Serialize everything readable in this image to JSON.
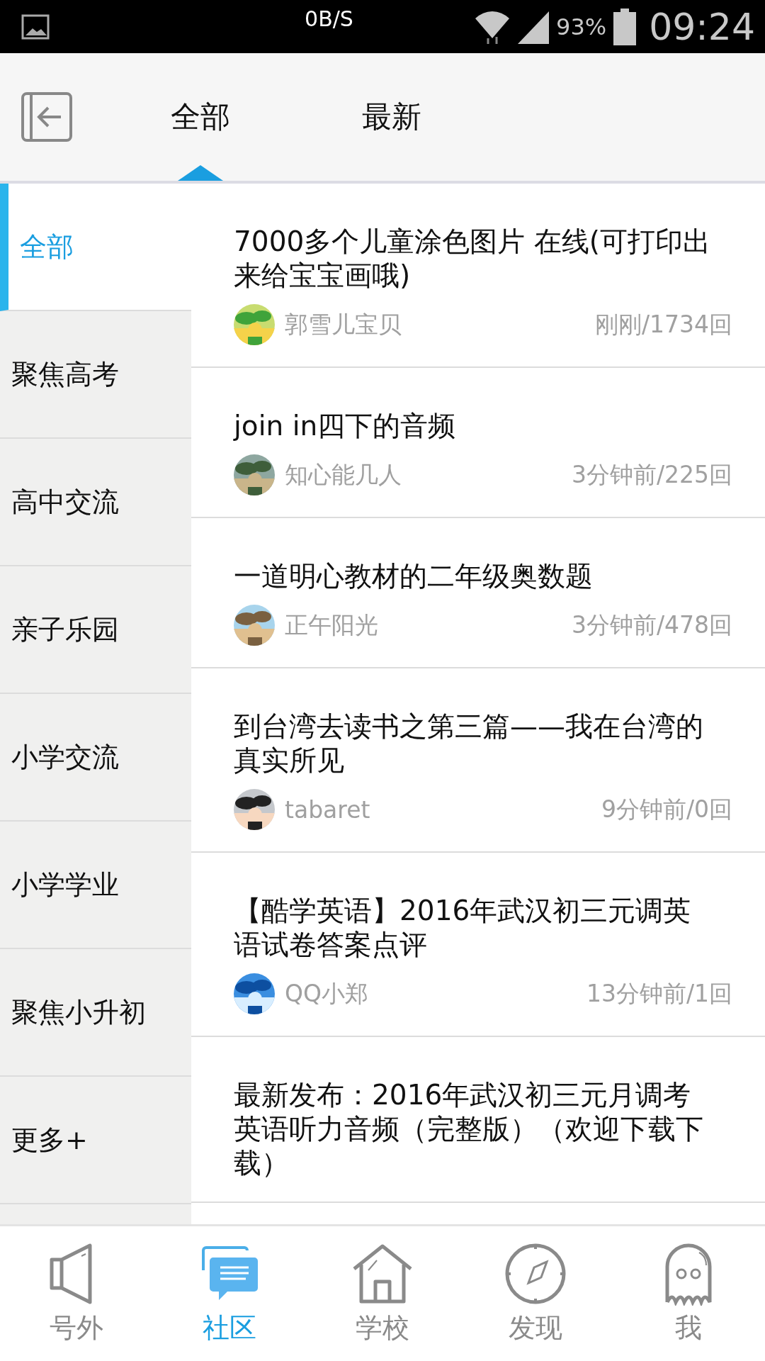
{
  "status_bar": {
    "speed": "0B/S",
    "battery": "93%",
    "time": "09:24"
  },
  "header": {
    "tabs": [
      {
        "label": "全部",
        "selected": true
      },
      {
        "label": "最新",
        "selected": false
      }
    ]
  },
  "sidebar": {
    "items": [
      {
        "label": "全部",
        "selected": true
      },
      {
        "label": "聚焦高考",
        "selected": false
      },
      {
        "label": "高中交流",
        "selected": false
      },
      {
        "label": "亲子乐园",
        "selected": false
      },
      {
        "label": "小学交流",
        "selected": false
      },
      {
        "label": "小学学业",
        "selected": false
      },
      {
        "label": "聚焦小升初",
        "selected": false
      },
      {
        "label": "更多+",
        "selected": false
      }
    ]
  },
  "posts": [
    {
      "title": "7000多个儿童涂色图片 在线(可打印出来给宝宝画哦)",
      "author": "郭雪儿宝贝",
      "meta": "刚刚/1734回"
    },
    {
      "title": "join in四下的音频",
      "author": "知心能几人",
      "meta": "3分钟前/225回"
    },
    {
      "title": "一道明心教材的二年级奥数题",
      "author": "正午阳光",
      "meta": "3分钟前/478回"
    },
    {
      "title": "到台湾去读书之第三篇——我在台湾的真实所见",
      "author": "tabaret",
      "meta": "9分钟前/0回"
    },
    {
      "title": "【酷学英语】2016年武汉初三元调英语试卷答案点评",
      "author": "QQ小郑",
      "meta": "13分钟前/1回"
    },
    {
      "title": "最新发布：2016年武汉初三元月调考英语听力音频（完整版）（欢迎下载下载）"
    }
  ],
  "bottom_nav": [
    {
      "label": "号外",
      "selected": false,
      "kind": "speaker"
    },
    {
      "label": "社区",
      "selected": true,
      "kind": "chat"
    },
    {
      "label": "学校",
      "selected": false,
      "kind": "house"
    },
    {
      "label": "发现",
      "selected": false,
      "kind": "compass"
    },
    {
      "label": "我",
      "selected": false,
      "kind": "ghost"
    }
  ]
}
